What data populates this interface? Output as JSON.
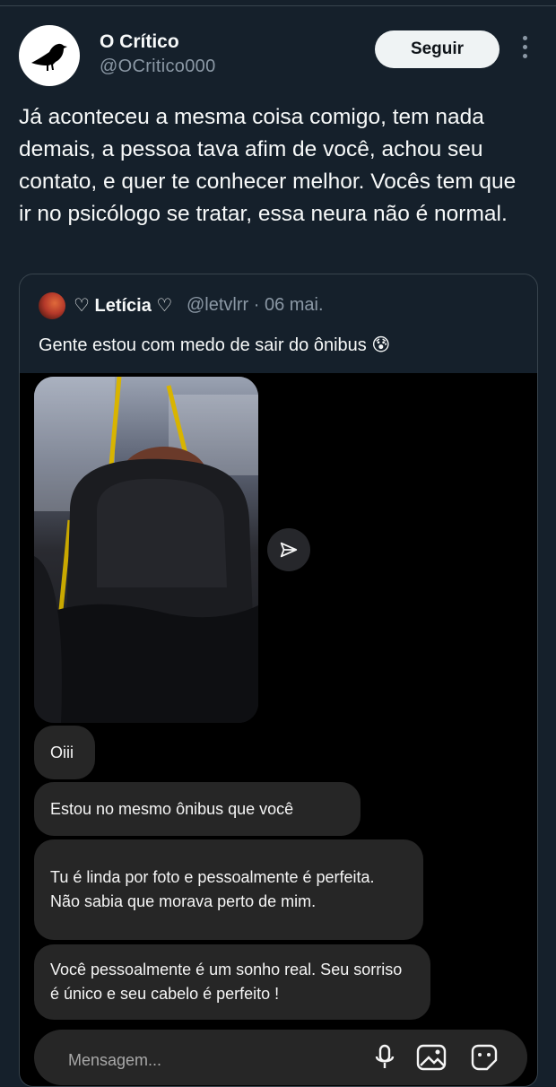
{
  "tweet": {
    "author_name": "O Crítico",
    "author_handle": "@OCritico000",
    "follow_label": "Seguir",
    "text": "Já aconteceu a mesma coisa comigo, tem nada demais, a pessoa tava afim de você, achou seu contato, e quer te conhecer melhor. Vocês tem que ir no psicólogo se tratar, essa neura não é normal."
  },
  "quoted": {
    "author_name": "♡ Letícia ♡",
    "author_handle": "@letvlrr · 06 mai.",
    "text": "Gente estou com medo de sair do ônibus 😰",
    "messages": [
      "Oiii",
      "Estou no mesmo ônibus que você",
      "Tu é linda por foto e pessoalmente é perfeita. Não sabia que morava perto de mim.",
      "Você pessoalmente é um sonho real. Seu sorriso é único e seu cabelo é perfeito !"
    ],
    "message_placeholder": "Mensagem..."
  },
  "icons": {
    "avatar": "crow-icon",
    "more": "more-vertical-icon",
    "share": "send-icon",
    "mic": "microphone-icon",
    "gallery": "gallery-icon",
    "sticker": "sticker-icon"
  },
  "colors": {
    "background": "#15202b",
    "border": "#38444d",
    "secondary_text": "#8b98a5",
    "dm_bubble": "#262626"
  }
}
